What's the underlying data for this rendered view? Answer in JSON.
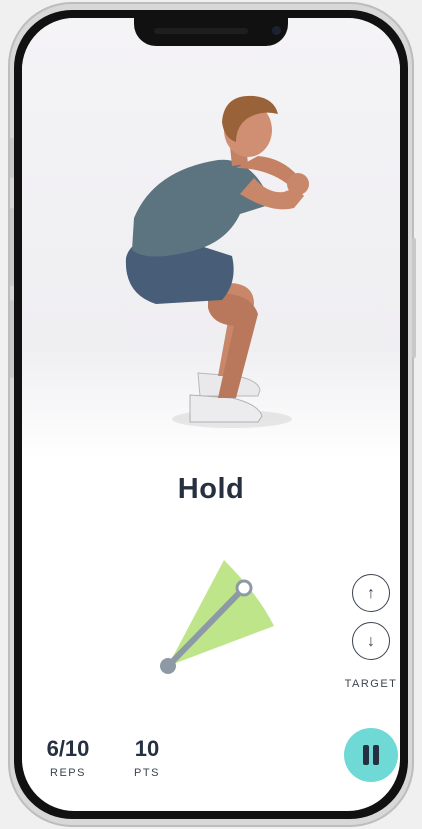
{
  "screen": {
    "status_title": "Hold"
  },
  "target": {
    "up_icon": "arrow-up-icon",
    "down_icon": "arrow-down-icon",
    "label": "TARGET"
  },
  "stats": {
    "reps_value": "6/10",
    "reps_label": "REPS",
    "pts_value": "10",
    "pts_label": "PTS"
  },
  "controls": {
    "pause_icon": "pause-icon"
  },
  "colors": {
    "accent_teal": "#6fd9d6",
    "gauge_green": "#bfe58a",
    "gauge_arm": "#8d9aa6",
    "text_dark": "#263040"
  }
}
